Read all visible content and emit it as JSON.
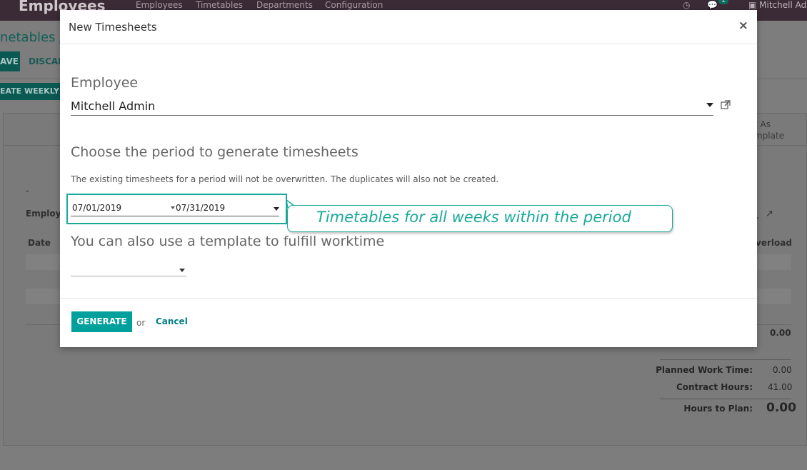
{
  "background": {
    "app_title": "Employees",
    "menu": [
      "Employees",
      "Timetables",
      "Departments",
      "Configuration"
    ],
    "chat_count": "1",
    "user_name": "Mitchell Ad",
    "breadcrumb": "netables /",
    "save_label": "AVE",
    "discard_label": "DISCAR",
    "create_weekly_label": "EATE WEEKLY",
    "template_label_line1": "t As",
    "template_label_line2": "mplate",
    "dash": "-",
    "employee_label": "Employe",
    "date_col": "Date",
    "overload_col": "verload",
    "total_value": "0.00",
    "summary": {
      "planned_label": "Planned Work Time:",
      "planned_value": "0.00",
      "contract_label": "Contract Hours:",
      "contract_value": "41.00",
      "hours_label": "Hours to Plan:",
      "hours_value": "0.00"
    }
  },
  "modal": {
    "title": "New Timesheets",
    "close_glyph": "×",
    "employee_label": "Employee",
    "employee_value": "Mitchell Admin",
    "period_heading": "Choose the period to generate timesheets",
    "period_note": "The existing timesheets for a period will not be overwritten. The duplicates will also not be created.",
    "date_from": "07/01/2019",
    "date_to": "07/31/2019",
    "template_heading": "You can also use a template to fulfill worktime",
    "template_value": "",
    "generate_label": "GENERATE",
    "or_text": "or",
    "cancel_label": "Cancel"
  },
  "callout": {
    "text": "Timetables for all weeks within the period"
  },
  "colors": {
    "accent": "#00a09d",
    "callout": "#1aa99a",
    "link": "#017e84"
  }
}
